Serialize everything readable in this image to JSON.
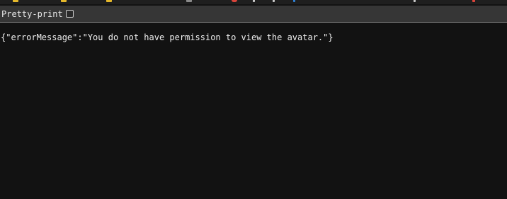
{
  "browser_tab_strip": {
    "icon_colors": [
      "#e5b82b",
      "#e5b82b",
      "#e5b82b",
      "#8a8a8a",
      "#d9443a",
      "#c9c9c9",
      "#2f7fd1",
      "#d9443a"
    ]
  },
  "toolbar": {
    "pretty_print_label": "Pretty-print",
    "pretty_print_checked": false
  },
  "response": {
    "raw_text": "{\"errorMessage\":\"You do not have permission to view the avatar.\"}"
  }
}
